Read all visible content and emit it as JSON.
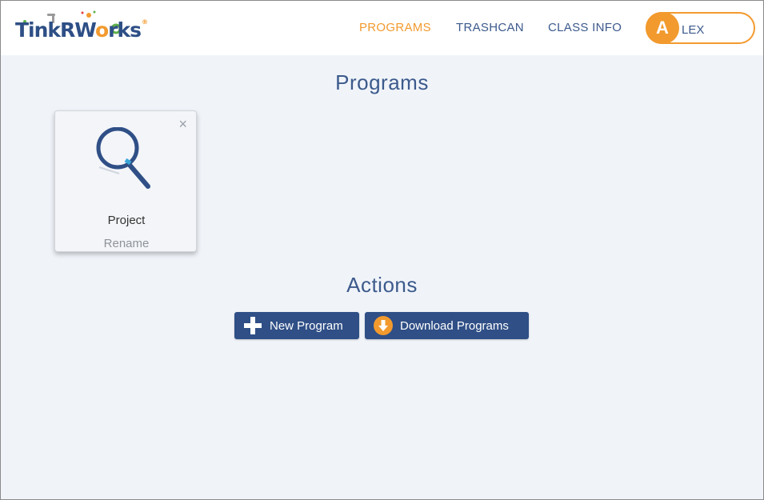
{
  "brand": {
    "logo_text_a": "T",
    "logo_text_b": "INKRW",
    "logo_text_c": "O",
    "logo_text_d": "RKS",
    "logo_alt": "TinkRWorks",
    "accent": "#f29a2e",
    "primary": "#2f4f86"
  },
  "nav": {
    "programs": "PROGRAMS",
    "trashcan": "TRASHCAN",
    "class_info": "CLASS INFO"
  },
  "user": {
    "initial": "A",
    "name": "LEX"
  },
  "programs_section": {
    "title": "Programs",
    "cards": [
      {
        "name": "Project",
        "rename": "Rename",
        "close": "×",
        "icon": "magnifier-icon"
      }
    ]
  },
  "actions_section": {
    "title": "Actions",
    "new_program": "New Program",
    "download_programs": "Download Programs"
  }
}
